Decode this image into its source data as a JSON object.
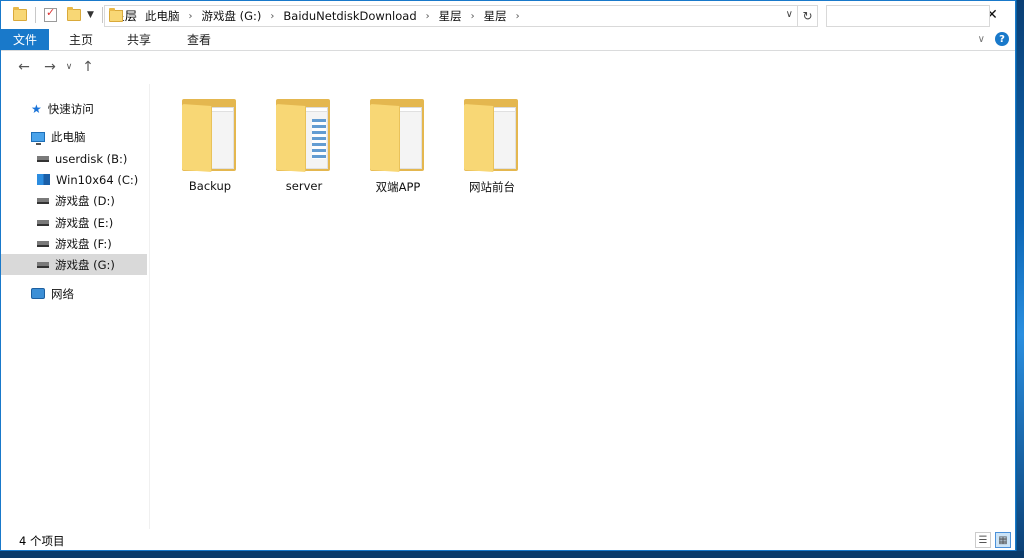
{
  "window": {
    "title": "星层",
    "controls": {
      "minimize": "—",
      "maximize": "☐",
      "close": "✕"
    }
  },
  "ribbon": {
    "tabs": [
      {
        "label": "文件"
      },
      {
        "label": "主页"
      },
      {
        "label": "共享"
      },
      {
        "label": "查看"
      }
    ]
  },
  "address": {
    "crumbs": [
      "此电脑",
      "游戏盘 (G:)",
      "BaiduNetdiskDownload",
      "星层",
      "星层"
    ],
    "search_placeholder": ""
  },
  "nav_pane": {
    "quick_access": "快速访问",
    "this_pc": "此电脑",
    "drives": [
      {
        "label": "userdisk (B:)",
        "icon": "drive-icon"
      },
      {
        "label": "Win10x64 (C:)",
        "icon": "windows-drive-icon"
      },
      {
        "label": "游戏盘 (D:)",
        "icon": "drive-icon"
      },
      {
        "label": "游戏盘 (E:)",
        "icon": "drive-icon"
      },
      {
        "label": "游戏盘 (F:)",
        "icon": "drive-icon"
      },
      {
        "label": "游戏盘 (G:)",
        "icon": "drive-icon",
        "selected": true
      }
    ],
    "network": "网络"
  },
  "folders": [
    {
      "name": "Backup"
    },
    {
      "name": "server"
    },
    {
      "name": "双端APP"
    },
    {
      "name": "网站前台"
    }
  ],
  "status": {
    "item_count": "4 个项目"
  },
  "colors": {
    "accent": "#1979ca",
    "folder": "#f8d775",
    "selected_nav": "#d9d9d9"
  }
}
